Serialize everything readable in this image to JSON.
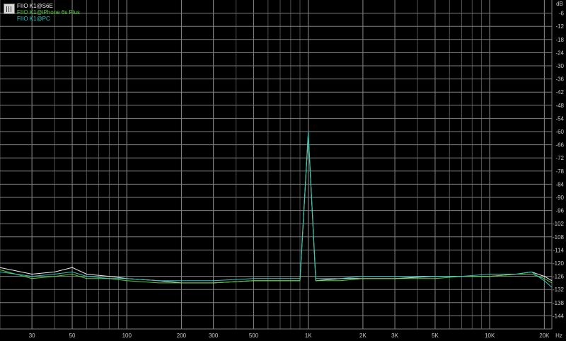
{
  "chart_data": {
    "type": "line",
    "title": "",
    "xlabel": "",
    "ylabel": "",
    "x_unit": "Hz",
    "y_unit": "dB",
    "x_scale": "log",
    "xlim": [
      20,
      22000
    ],
    "ylim": [
      -150,
      0
    ],
    "x_ticks": [
      {
        "v": 30,
        "label": "30"
      },
      {
        "v": 50,
        "label": "50"
      },
      {
        "v": 100,
        "label": "100"
      },
      {
        "v": 200,
        "label": "200"
      },
      {
        "v": 300,
        "label": "300"
      },
      {
        "v": 500,
        "label": "500"
      },
      {
        "v": 1000,
        "label": "1K"
      },
      {
        "v": 2000,
        "label": "2K"
      },
      {
        "v": 3000,
        "label": "3K"
      },
      {
        "v": 5000,
        "label": "5K"
      },
      {
        "v": 10000,
        "label": "10K"
      },
      {
        "v": 20000,
        "label": "20K"
      }
    ],
    "y_ticks": [
      -6,
      -12,
      -18,
      -24,
      -30,
      -36,
      -42,
      -48,
      -54,
      -60,
      -66,
      -72,
      -78,
      -84,
      -90,
      -96,
      -102,
      -108,
      -114,
      -120,
      -126,
      -132,
      -138,
      -144
    ],
    "grid": true,
    "legend": "top-left",
    "series": [
      {
        "name": "FIIO K1@S6E",
        "color": "#f0f0f0",
        "x": [
          20,
          30,
          40,
          50,
          60,
          80,
          100,
          150,
          200,
          300,
          500,
          700,
          900,
          1000,
          1100,
          1500,
          2000,
          3000,
          5000,
          7000,
          10000,
          14000,
          17000,
          20000,
          22000
        ],
        "y": [
          -122,
          -125,
          -124,
          -122,
          -125,
          -126,
          -127,
          -128,
          -129,
          -129,
          -128,
          -128,
          -128,
          -61,
          -128,
          -127,
          -127,
          -127,
          -126,
          -126,
          -126,
          -125,
          -124,
          -126,
          -128
        ]
      },
      {
        "name": "FIIO K1@iPhone 6s Plus",
        "color": "#56c83a",
        "x": [
          20,
          30,
          40,
          50,
          60,
          80,
          100,
          150,
          200,
          300,
          500,
          700,
          900,
          1000,
          1100,
          1500,
          2000,
          3000,
          5000,
          7000,
          10000,
          14000,
          17000,
          20000,
          22000
        ],
        "y": [
          -123,
          -127,
          -126,
          -125,
          -127,
          -127,
          -128,
          -129,
          -129,
          -129,
          -128,
          -128,
          -128,
          -61,
          -128,
          -128,
          -127,
          -127,
          -127,
          -126,
          -126,
          -125,
          -125,
          -127,
          -129
        ]
      },
      {
        "name": "FIIO K1@PC",
        "color": "#2ec8c0",
        "x": [
          20,
          30,
          40,
          50,
          60,
          80,
          100,
          150,
          200,
          300,
          500,
          700,
          900,
          1000,
          1100,
          1500,
          2000,
          3000,
          5000,
          7000,
          10000,
          14000,
          17000,
          20000,
          22000
        ],
        "y": [
          -124,
          -126,
          -125,
          -124,
          -126,
          -127,
          -127,
          -128,
          -128,
          -128,
          -127,
          -127,
          -127,
          -60,
          -127,
          -127,
          -126,
          -126,
          -126,
          -126,
          -125,
          -125,
          -124,
          -128,
          -131
        ]
      }
    ]
  },
  "colors": {
    "background": "#000000",
    "grid": "#808080",
    "grid_minor": "#505050",
    "tick_label": "#c8c8c8"
  }
}
